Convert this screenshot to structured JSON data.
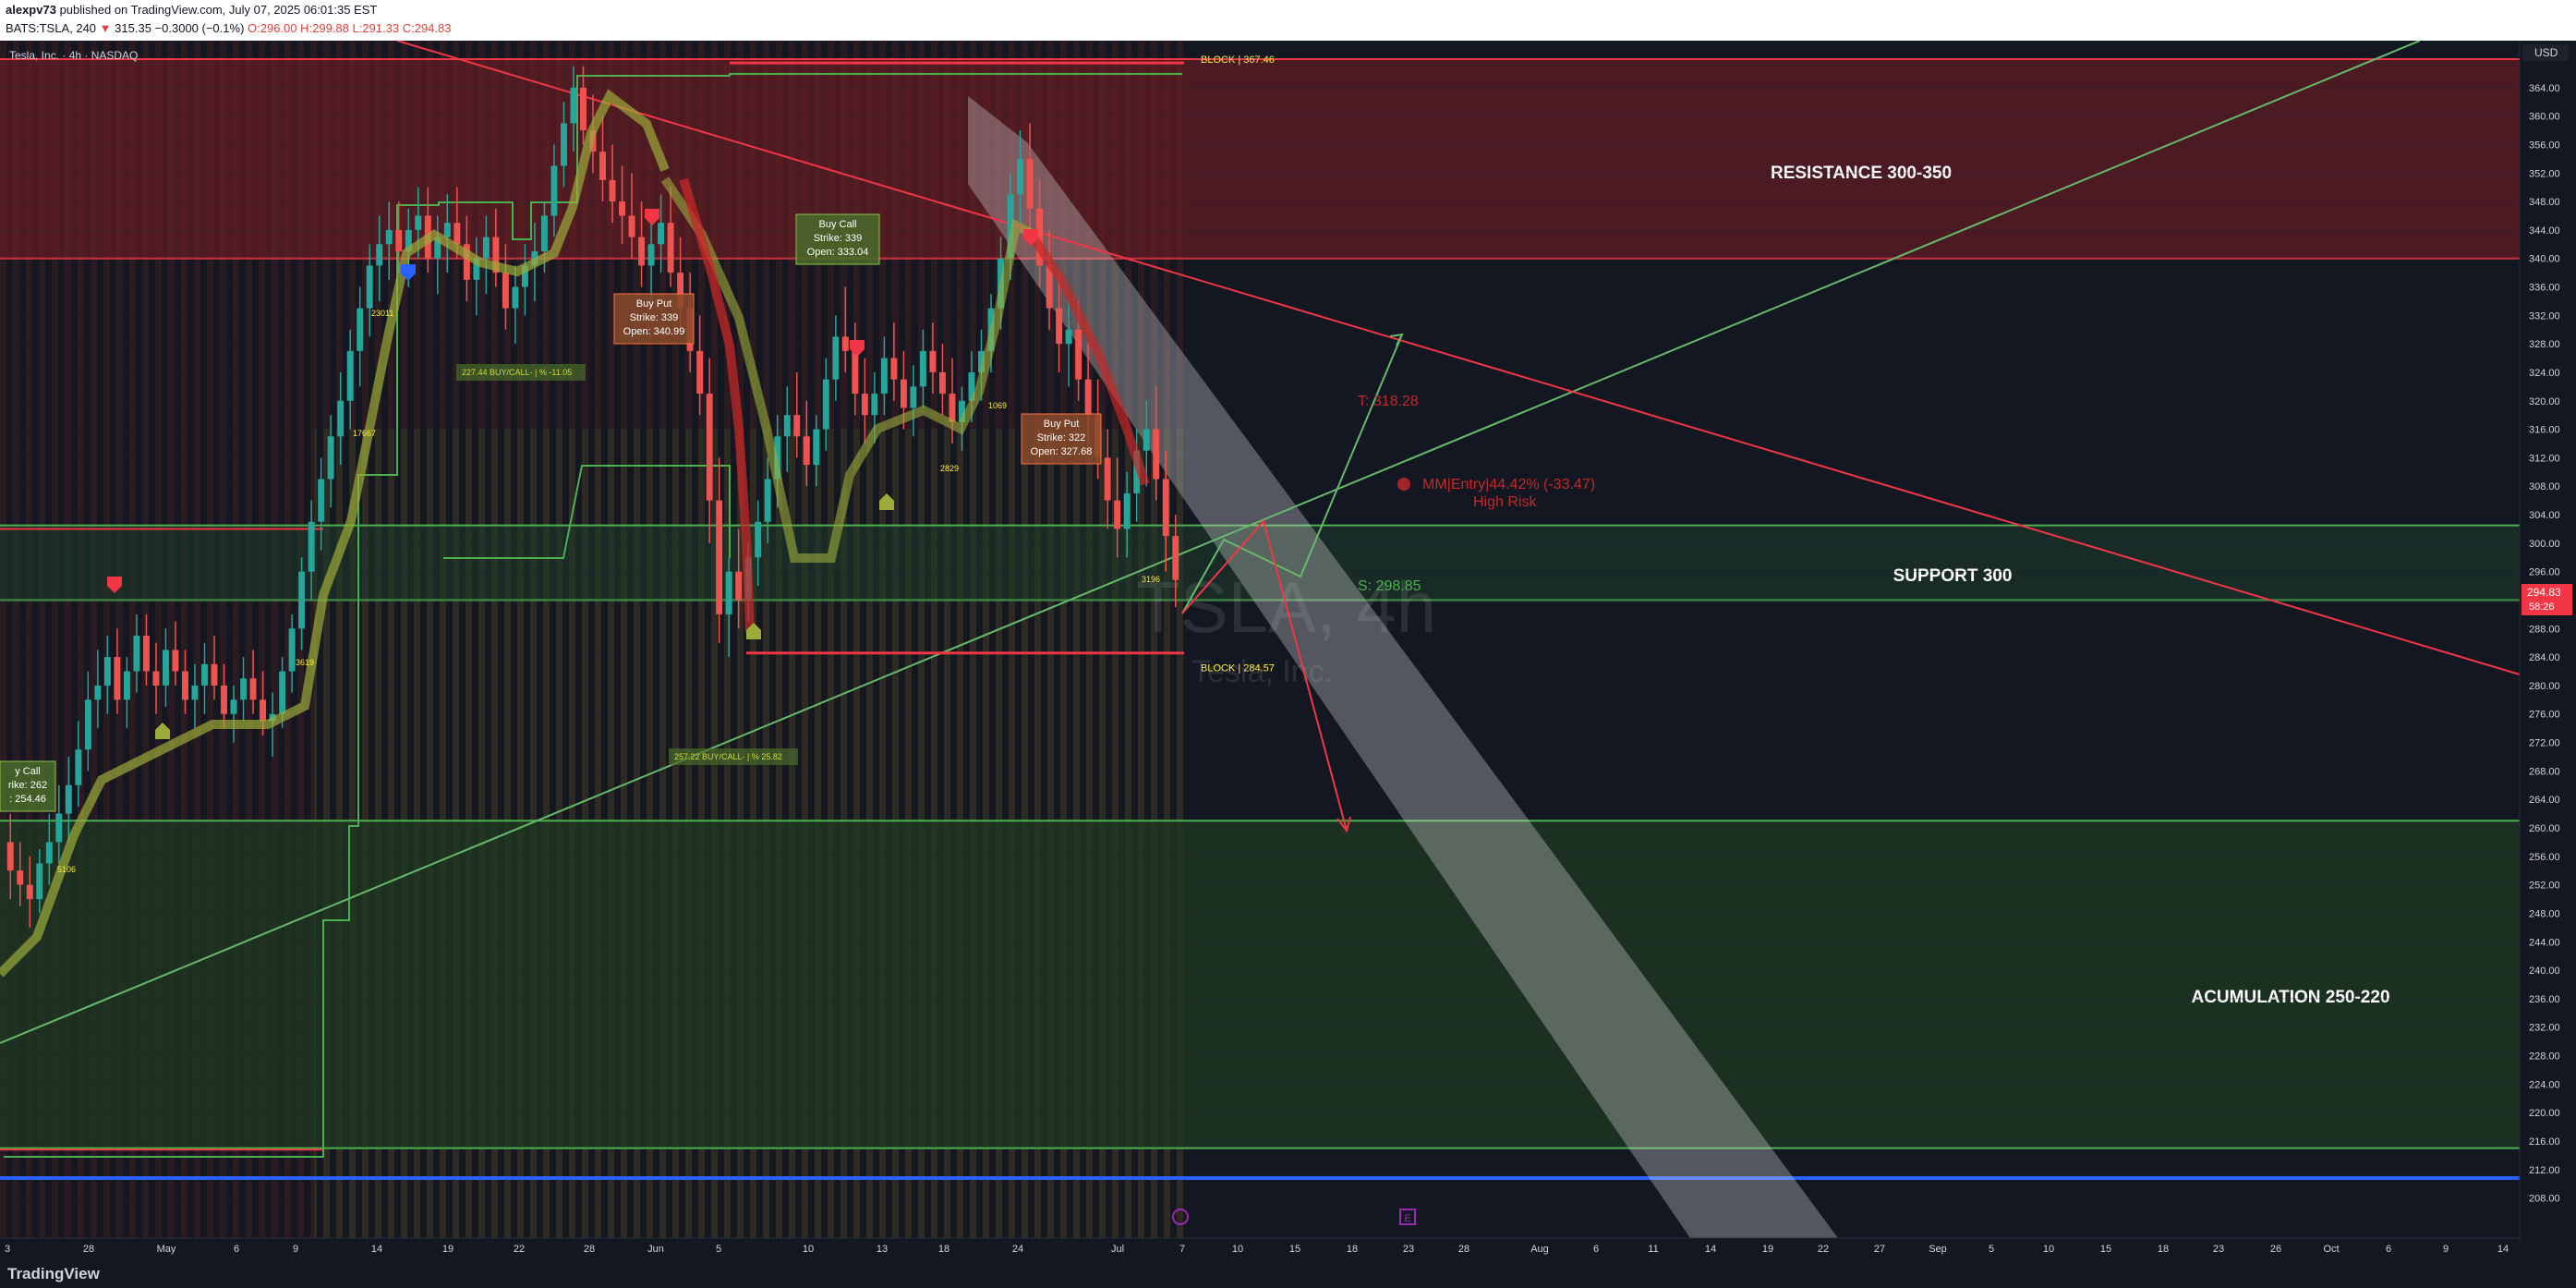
{
  "header": {
    "publisher": "alexpv73",
    "published_on": "published on TradingView.com, July 07, 2025 06:01:35 EST",
    "symbol_line": "BATS:TSLA, 240",
    "last": "315.35",
    "change": "−0.3000 (−0.1%)",
    "ohlc": "O:296.00 H:299.88 L:291.33 C:294.83"
  },
  "chart_title": "Tesla, Inc. · 4h · NASDAQ",
  "currency_button": "USD",
  "watermark": {
    "symbol": "TSLA, 4h",
    "name": "Tesla, Inc."
  },
  "footer_logo": "TradingView",
  "price_tag": {
    "price": "294.83",
    "countdown": "58:26"
  },
  "colors": {
    "bg": "#131722",
    "up": "#26a69a",
    "down": "#ef5350",
    "green_line": "#4caf50",
    "red_line": "#f23645",
    "blue_line": "#2962ff"
  },
  "chart_data": {
    "type": "candlestick",
    "title": "Tesla, Inc. · 4h · NASDAQ",
    "ylim": [
      206,
      368
    ],
    "y_ticks": [
      208,
      212,
      216,
      220,
      224,
      228,
      232,
      236,
      240,
      244,
      248,
      252,
      256,
      260,
      264,
      268,
      272,
      276,
      280,
      284,
      288,
      292,
      296,
      300,
      304,
      308,
      312,
      316,
      320,
      324,
      328,
      332,
      336,
      340,
      344,
      348,
      352,
      356,
      360,
      364
    ],
    "x_ticks": [
      "3",
      "28",
      "May",
      "6",
      "9",
      "14",
      "19",
      "22",
      "28",
      "Jun",
      "5",
      "10",
      "13",
      "18",
      "24",
      "Jul",
      "7",
      "10",
      "15",
      "18",
      "23",
      "28",
      "Aug",
      "6",
      "11",
      "14",
      "19",
      "22",
      "27",
      "Sep",
      "5",
      "10",
      "15",
      "18",
      "23",
      "26",
      "Oct",
      "6",
      "9",
      "14"
    ],
    "zones": [
      {
        "label": "RESISTANCE  300-350",
        "from": 340,
        "to": 368
      },
      {
        "label": "SUPPORT 300",
        "from": 292,
        "to": 302.5
      },
      {
        "label": "ACUMULATION 250-220",
        "from": 215,
        "to": 261
      }
    ],
    "levels": [
      {
        "label": "BLOCK | 367.46",
        "price": 367.46
      },
      {
        "label": "BLOCK | 284.57",
        "price": 284.57
      },
      {
        "label": "S: 298.85",
        "price": 298.85
      },
      {
        "label": "T: 318.28",
        "price": 318.28
      }
    ],
    "annotations": [
      {
        "title": "Buy Call",
        "line2": "Strike: 339",
        "line3": "Open: 333.04"
      },
      {
        "title": "Buy Put",
        "line2": "Strike: 339",
        "line3": "Open: 340.99"
      },
      {
        "title": "Buy Put",
        "line2": "Strike: 322",
        "line3": "Open: 327.68"
      },
      {
        "title": "y Call",
        "line2": "rike: 262",
        "line3": ": 254.46"
      }
    ],
    "risk_note": {
      "line1": "MM|Entry|44.42% (-33.47)",
      "line2": "High Risk"
    },
    "small_labels": [
      "227.44 BUY/CALL- | % -11.05",
      "257.22 BUY/CALL- | % 25.82",
      "3196",
      "2829",
      "1069",
      "5106",
      "17667",
      "23011",
      "3619"
    ],
    "candles": [
      [
        258,
        262,
        250,
        254
      ],
      [
        254,
        258,
        249,
        252
      ],
      [
        252,
        256,
        246,
        250
      ],
      [
        250,
        257,
        248,
        255
      ],
      [
        255,
        262,
        252,
        258
      ],
      [
        258,
        266,
        255,
        262
      ],
      [
        262,
        270,
        258,
        266
      ],
      [
        266,
        275,
        263,
        271
      ],
      [
        271,
        282,
        268,
        278
      ],
      [
        278,
        285,
        274,
        280
      ],
      [
        280,
        287,
        276,
        284
      ],
      [
        284,
        288,
        276,
        278
      ],
      [
        278,
        284,
        274,
        282
      ],
      [
        282,
        290,
        279,
        287
      ],
      [
        287,
        290,
        280,
        282
      ],
      [
        282,
        286,
        276,
        280
      ],
      [
        280,
        288,
        277,
        285
      ],
      [
        285,
        289,
        280,
        282
      ],
      [
        282,
        285,
        276,
        278
      ],
      [
        278,
        283,
        274,
        280
      ],
      [
        280,
        286,
        276,
        283
      ],
      [
        283,
        287,
        278,
        280
      ],
      [
        280,
        283,
        274,
        276
      ],
      [
        276,
        280,
        272,
        278
      ],
      [
        278,
        284,
        275,
        281
      ],
      [
        281,
        285,
        276,
        278
      ],
      [
        278,
        282,
        273,
        275
      ],
      [
        275,
        279,
        270,
        276
      ],
      [
        276,
        284,
        274,
        282
      ],
      [
        282,
        290,
        279,
        288
      ],
      [
        288,
        298,
        285,
        296
      ],
      [
        296,
        306,
        292,
        303
      ],
      [
        303,
        312,
        299,
        309
      ],
      [
        309,
        318,
        305,
        315
      ],
      [
        315,
        324,
        311,
        320
      ],
      [
        320,
        330,
        316,
        327
      ],
      [
        327,
        336,
        322,
        333
      ],
      [
        333,
        342,
        329,
        339
      ],
      [
        339,
        346,
        334,
        342
      ],
      [
        342,
        348,
        337,
        344
      ],
      [
        344,
        348,
        338,
        341
      ],
      [
        341,
        347,
        336,
        344
      ],
      [
        344,
        350,
        340,
        346
      ],
      [
        346,
        350,
        338,
        340
      ],
      [
        340,
        346,
        335,
        343
      ],
      [
        343,
        349,
        338,
        345
      ],
      [
        345,
        350,
        340,
        342
      ],
      [
        342,
        346,
        334,
        337
      ],
      [
        337,
        343,
        332,
        340
      ],
      [
        340,
        346,
        335,
        343
      ],
      [
        343,
        347,
        336,
        338
      ],
      [
        338,
        342,
        330,
        333
      ],
      [
        333,
        339,
        328,
        336
      ],
      [
        336,
        342,
        332,
        339
      ],
      [
        339,
        345,
        334,
        341
      ],
      [
        341,
        348,
        338,
        346
      ],
      [
        346,
        356,
        343,
        353
      ],
      [
        353,
        362,
        350,
        359
      ],
      [
        359,
        367,
        355,
        364
      ],
      [
        364,
        367,
        356,
        358
      ],
      [
        358,
        363,
        352,
        355
      ],
      [
        355,
        360,
        348,
        351
      ],
      [
        351,
        356,
        345,
        348
      ],
      [
        348,
        353,
        342,
        346
      ],
      [
        346,
        352,
        340,
        343
      ],
      [
        343,
        348,
        336,
        339
      ],
      [
        339,
        345,
        334,
        342
      ],
      [
        342,
        349,
        338,
        345
      ],
      [
        345,
        350,
        336,
        338
      ],
      [
        338,
        343,
        330,
        333
      ],
      [
        333,
        338,
        324,
        327
      ],
      [
        327,
        332,
        318,
        321
      ],
      [
        321,
        326,
        300,
        306
      ],
      [
        306,
        312,
        286,
        290
      ],
      [
        290,
        298,
        284,
        296
      ],
      [
        296,
        302,
        288,
        292
      ],
      [
        292,
        300,
        289,
        298
      ],
      [
        298,
        306,
        294,
        303
      ],
      [
        303,
        312,
        300,
        309
      ],
      [
        309,
        318,
        305,
        315
      ],
      [
        315,
        322,
        310,
        318
      ],
      [
        318,
        324,
        312,
        315
      ],
      [
        315,
        320,
        308,
        311
      ],
      [
        311,
        318,
        308,
        316
      ],
      [
        316,
        326,
        313,
        323
      ],
      [
        323,
        332,
        320,
        329
      ],
      [
        329,
        336,
        324,
        327
      ],
      [
        327,
        331,
        318,
        321
      ],
      [
        321,
        326,
        314,
        318
      ],
      [
        318,
        324,
        314,
        321
      ],
      [
        321,
        329,
        318,
        326
      ],
      [
        326,
        331,
        320,
        323
      ],
      [
        323,
        327,
        316,
        319
      ],
      [
        319,
        325,
        315,
        322
      ],
      [
        322,
        330,
        319,
        327
      ],
      [
        327,
        331,
        321,
        324
      ],
      [
        324,
        328,
        318,
        321
      ],
      [
        321,
        326,
        314,
        317
      ],
      [
        317,
        322,
        313,
        320
      ],
      [
        320,
        327,
        317,
        324
      ],
      [
        324,
        330,
        320,
        327
      ],
      [
        327,
        335,
        324,
        333
      ],
      [
        333,
        343,
        330,
        340
      ],
      [
        340,
        352,
        337,
        349
      ],
      [
        349,
        358,
        345,
        354
      ],
      [
        354,
        359,
        344,
        347
      ],
      [
        347,
        351,
        336,
        339
      ],
      [
        339,
        344,
        330,
        333
      ],
      [
        333,
        338,
        324,
        328
      ],
      [
        328,
        334,
        322,
        330
      ],
      [
        330,
        334,
        320,
        323
      ],
      [
        323,
        328,
        314,
        318
      ],
      [
        318,
        323,
        309,
        312
      ],
      [
        312,
        316,
        302,
        306
      ],
      [
        306,
        312,
        298,
        302
      ],
      [
        302,
        310,
        298,
        307
      ],
      [
        307,
        316,
        303,
        313
      ],
      [
        313,
        320,
        308,
        316
      ],
      [
        316,
        322,
        306,
        309
      ],
      [
        309,
        313,
        296,
        301
      ],
      [
        301,
        304,
        291,
        294.83
      ]
    ]
  }
}
